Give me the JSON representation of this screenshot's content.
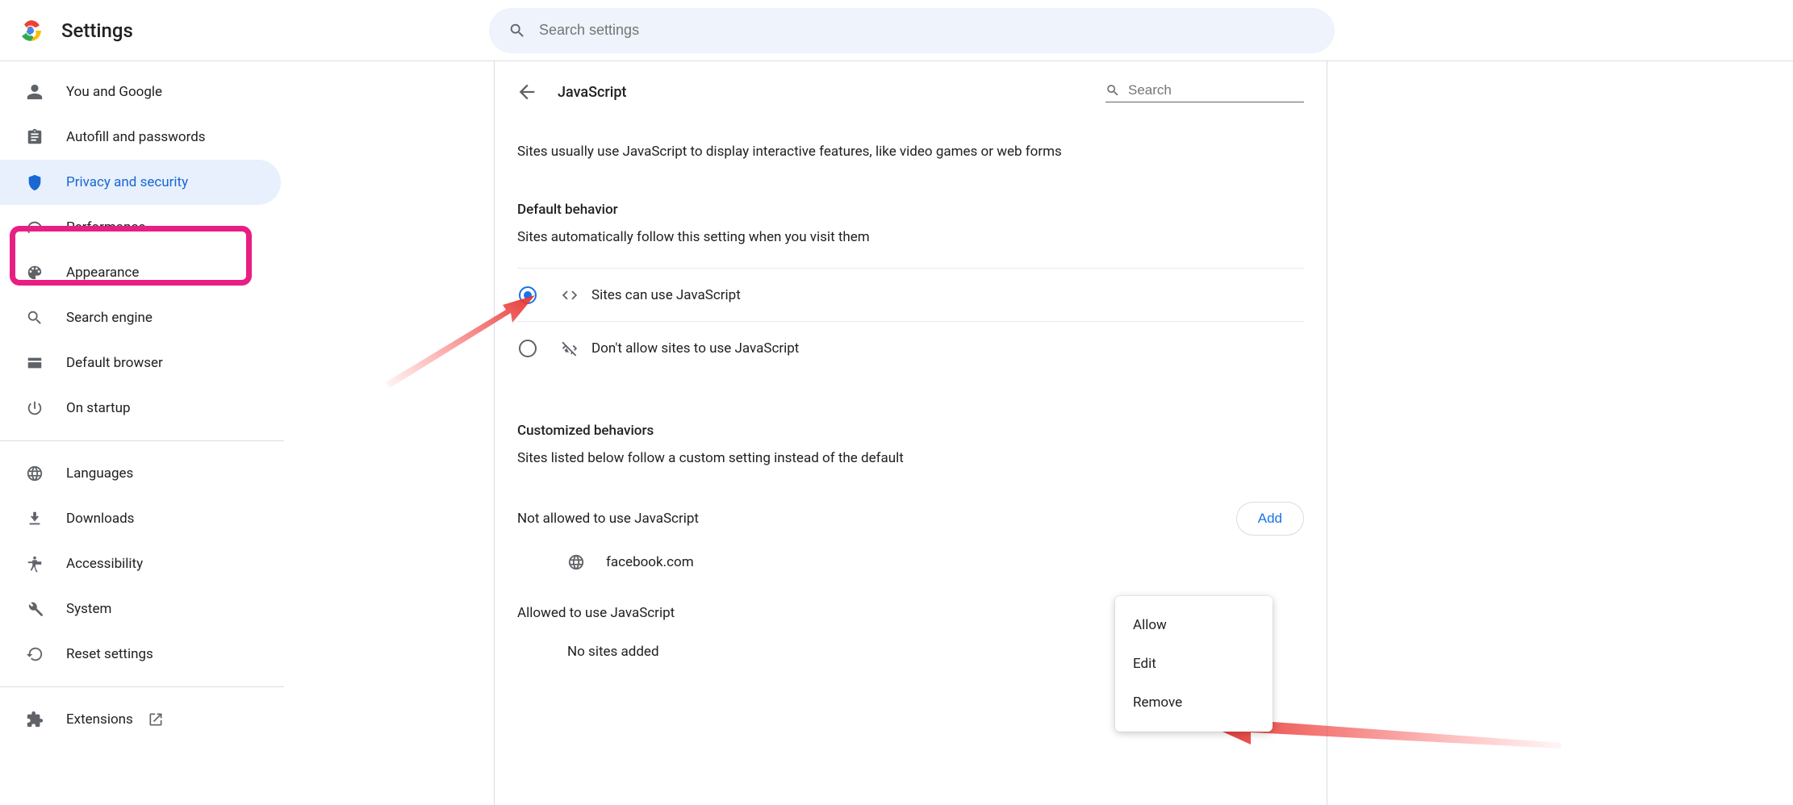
{
  "header": {
    "title": "Settings",
    "search_placeholder": "Search settings"
  },
  "sidebar": {
    "items": [
      {
        "label": "You and Google"
      },
      {
        "label": "Autofill and passwords"
      },
      {
        "label": "Privacy and security"
      },
      {
        "label": "Performance"
      },
      {
        "label": "Appearance"
      },
      {
        "label": "Search engine"
      },
      {
        "label": "Default browser"
      },
      {
        "label": "On startup"
      }
    ],
    "group2": [
      {
        "label": "Languages"
      },
      {
        "label": "Downloads"
      },
      {
        "label": "Accessibility"
      },
      {
        "label": "System"
      },
      {
        "label": "Reset settings"
      }
    ],
    "extensions_label": "Extensions"
  },
  "main": {
    "page_title": "JavaScript",
    "search_placeholder": "Search",
    "intro": "Sites usually use JavaScript to display interactive features, like video games or web forms",
    "default_behavior_heading": "Default behavior",
    "default_behavior_sub": "Sites automatically follow this setting when you visit them",
    "radio_allow": "Sites can use JavaScript",
    "radio_block": "Don't allow sites to use JavaScript",
    "custom_heading": "Customized behaviors",
    "custom_sub": "Sites listed below follow a custom setting instead of the default",
    "not_allowed_heading": "Not allowed to use JavaScript",
    "add_label": "Add",
    "blocked_sites": [
      {
        "host": "facebook.com"
      }
    ],
    "allowed_heading": "Allowed to use JavaScript",
    "no_sites": "No sites added"
  },
  "ctx": {
    "allow": "Allow",
    "edit": "Edit",
    "remove": "Remove"
  }
}
